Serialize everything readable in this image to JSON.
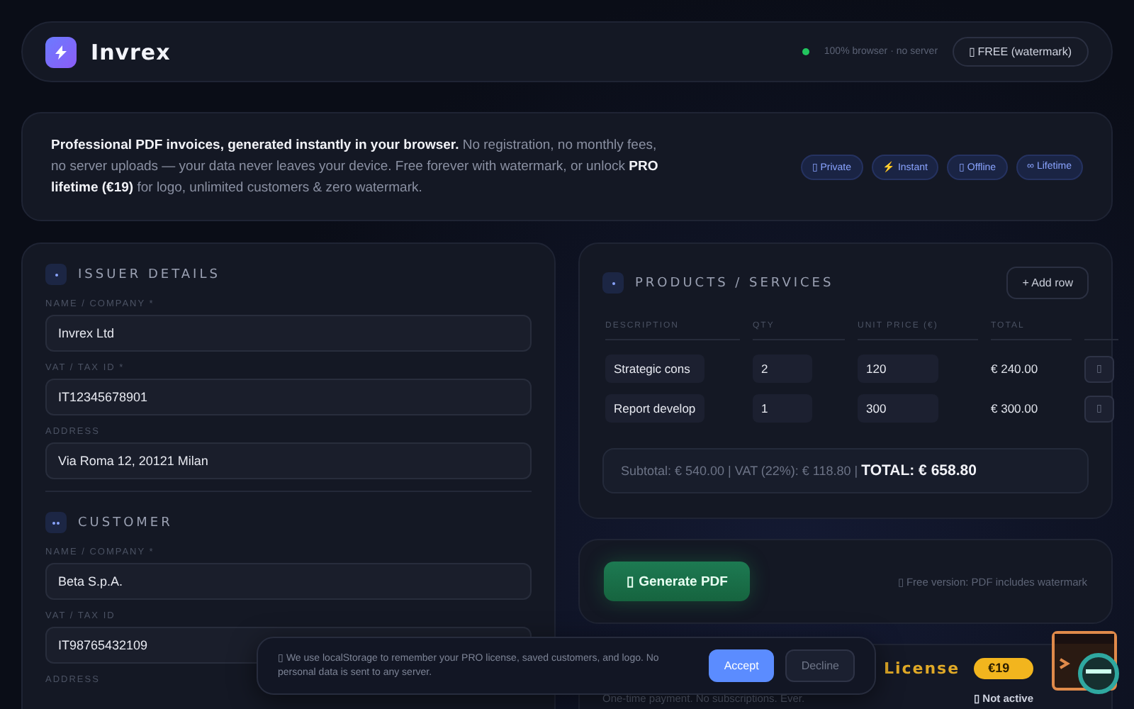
{
  "header": {
    "logo_text": "Invrex",
    "status": "100% browser · no server",
    "plan_button": "▯ FREE (watermark)"
  },
  "intro": {
    "text": "**Professional PDF invoices, generated instantly in your browser.** No registration, no monthly fees, no server uploads — your data never leaves your device. Free forever with watermark, or unlock **PRO lifetime (€19)** for logo, unlimited customers & zero watermark.",
    "badges": [
      "▯ Private",
      "⚡ Instant",
      "▯ Offline",
      "∞ Lifetime"
    ]
  },
  "issuer": {
    "title": "ISSUER DETAILS",
    "fields": [
      {
        "label": "NAME / COMPANY *",
        "value": "Invrex Ltd"
      },
      {
        "label": "VAT / TAX ID *",
        "value": "IT12345678901"
      },
      {
        "label": "ADDRESS",
        "value": "Via Roma 12, 20121 Milan"
      }
    ]
  },
  "customer": {
    "title": "CUSTOMER",
    "fields": [
      {
        "label": "NAME / COMPANY *",
        "value": "Beta S.p.A."
      },
      {
        "label": "VAT / TAX ID",
        "value": "IT98765432109"
      },
      {
        "label": "ADDRESS"
      }
    ]
  },
  "products": {
    "title": "PRODUCTS / SERVICES",
    "add_button": "+ Add row",
    "columns": [
      "DESCRIPTION",
      "QTY",
      "UNIT PRICE (€)",
      "TOTAL"
    ],
    "rows": [
      {
        "description": "Strategic cons",
        "qty": "2",
        "unit_price": "120",
        "total": "€ 240.00",
        "delete": "▯"
      },
      {
        "description": "Report develop",
        "qty": "1",
        "unit_price": "300",
        "total": "€ 300.00",
        "delete": "▯"
      }
    ],
    "summary": "Subtotal: € 540.00 | VAT (22%): € 118.80 | **TOTAL: € 658.80**"
  },
  "generate": {
    "button": "▯ Generate PDF",
    "note": "▯ Free version: PDF includes watermark"
  },
  "license": {
    "title": "License",
    "subtitle": "One-time payment. No subscriptions. Ever.",
    "price": "€19",
    "status": "▯ Not active"
  },
  "cookie_banner": {
    "text": "▯ We use localStorage to remember your PRO license, saved customers, and logo. No personal data is sent to any server.",
    "buttons": [
      {
        "label": "Accept",
        "kind": "primary"
      },
      {
        "label": "Decline",
        "kind": "secondary"
      }
    ]
  }
}
